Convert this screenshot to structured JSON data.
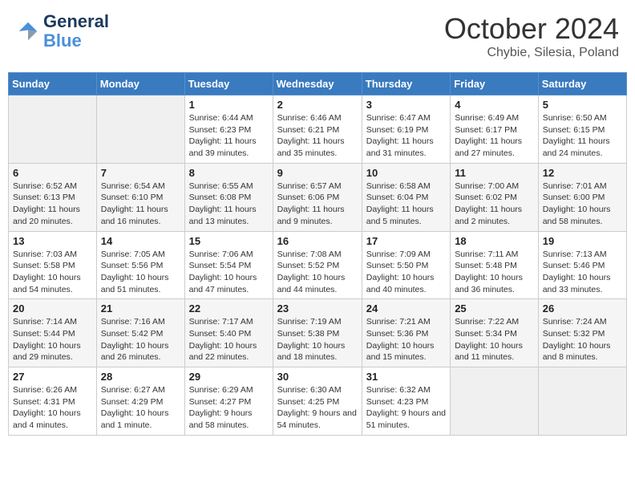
{
  "header": {
    "logo_line1": "General",
    "logo_line2": "Blue",
    "month": "October 2024",
    "location": "Chybie, Silesia, Poland"
  },
  "weekdays": [
    "Sunday",
    "Monday",
    "Tuesday",
    "Wednesday",
    "Thursday",
    "Friday",
    "Saturday"
  ],
  "weeks": [
    [
      {
        "day": "",
        "info": ""
      },
      {
        "day": "",
        "info": ""
      },
      {
        "day": "1",
        "info": "Sunrise: 6:44 AM\nSunset: 6:23 PM\nDaylight: 11 hours and 39 minutes."
      },
      {
        "day": "2",
        "info": "Sunrise: 6:46 AM\nSunset: 6:21 PM\nDaylight: 11 hours and 35 minutes."
      },
      {
        "day": "3",
        "info": "Sunrise: 6:47 AM\nSunset: 6:19 PM\nDaylight: 11 hours and 31 minutes."
      },
      {
        "day": "4",
        "info": "Sunrise: 6:49 AM\nSunset: 6:17 PM\nDaylight: 11 hours and 27 minutes."
      },
      {
        "day": "5",
        "info": "Sunrise: 6:50 AM\nSunset: 6:15 PM\nDaylight: 11 hours and 24 minutes."
      }
    ],
    [
      {
        "day": "6",
        "info": "Sunrise: 6:52 AM\nSunset: 6:13 PM\nDaylight: 11 hours and 20 minutes."
      },
      {
        "day": "7",
        "info": "Sunrise: 6:54 AM\nSunset: 6:10 PM\nDaylight: 11 hours and 16 minutes."
      },
      {
        "day": "8",
        "info": "Sunrise: 6:55 AM\nSunset: 6:08 PM\nDaylight: 11 hours and 13 minutes."
      },
      {
        "day": "9",
        "info": "Sunrise: 6:57 AM\nSunset: 6:06 PM\nDaylight: 11 hours and 9 minutes."
      },
      {
        "day": "10",
        "info": "Sunrise: 6:58 AM\nSunset: 6:04 PM\nDaylight: 11 hours and 5 minutes."
      },
      {
        "day": "11",
        "info": "Sunrise: 7:00 AM\nSunset: 6:02 PM\nDaylight: 11 hours and 2 minutes."
      },
      {
        "day": "12",
        "info": "Sunrise: 7:01 AM\nSunset: 6:00 PM\nDaylight: 10 hours and 58 minutes."
      }
    ],
    [
      {
        "day": "13",
        "info": "Sunrise: 7:03 AM\nSunset: 5:58 PM\nDaylight: 10 hours and 54 minutes."
      },
      {
        "day": "14",
        "info": "Sunrise: 7:05 AM\nSunset: 5:56 PM\nDaylight: 10 hours and 51 minutes."
      },
      {
        "day": "15",
        "info": "Sunrise: 7:06 AM\nSunset: 5:54 PM\nDaylight: 10 hours and 47 minutes."
      },
      {
        "day": "16",
        "info": "Sunrise: 7:08 AM\nSunset: 5:52 PM\nDaylight: 10 hours and 44 minutes."
      },
      {
        "day": "17",
        "info": "Sunrise: 7:09 AM\nSunset: 5:50 PM\nDaylight: 10 hours and 40 minutes."
      },
      {
        "day": "18",
        "info": "Sunrise: 7:11 AM\nSunset: 5:48 PM\nDaylight: 10 hours and 36 minutes."
      },
      {
        "day": "19",
        "info": "Sunrise: 7:13 AM\nSunset: 5:46 PM\nDaylight: 10 hours and 33 minutes."
      }
    ],
    [
      {
        "day": "20",
        "info": "Sunrise: 7:14 AM\nSunset: 5:44 PM\nDaylight: 10 hours and 29 minutes."
      },
      {
        "day": "21",
        "info": "Sunrise: 7:16 AM\nSunset: 5:42 PM\nDaylight: 10 hours and 26 minutes."
      },
      {
        "day": "22",
        "info": "Sunrise: 7:17 AM\nSunset: 5:40 PM\nDaylight: 10 hours and 22 minutes."
      },
      {
        "day": "23",
        "info": "Sunrise: 7:19 AM\nSunset: 5:38 PM\nDaylight: 10 hours and 18 minutes."
      },
      {
        "day": "24",
        "info": "Sunrise: 7:21 AM\nSunset: 5:36 PM\nDaylight: 10 hours and 15 minutes."
      },
      {
        "day": "25",
        "info": "Sunrise: 7:22 AM\nSunset: 5:34 PM\nDaylight: 10 hours and 11 minutes."
      },
      {
        "day": "26",
        "info": "Sunrise: 7:24 AM\nSunset: 5:32 PM\nDaylight: 10 hours and 8 minutes."
      }
    ],
    [
      {
        "day": "27",
        "info": "Sunrise: 6:26 AM\nSunset: 4:31 PM\nDaylight: 10 hours and 4 minutes."
      },
      {
        "day": "28",
        "info": "Sunrise: 6:27 AM\nSunset: 4:29 PM\nDaylight: 10 hours and 1 minute."
      },
      {
        "day": "29",
        "info": "Sunrise: 6:29 AM\nSunset: 4:27 PM\nDaylight: 9 hours and 58 minutes."
      },
      {
        "day": "30",
        "info": "Sunrise: 6:30 AM\nSunset: 4:25 PM\nDaylight: 9 hours and 54 minutes."
      },
      {
        "day": "31",
        "info": "Sunrise: 6:32 AM\nSunset: 4:23 PM\nDaylight: 9 hours and 51 minutes."
      },
      {
        "day": "",
        "info": ""
      },
      {
        "day": "",
        "info": ""
      }
    ]
  ]
}
